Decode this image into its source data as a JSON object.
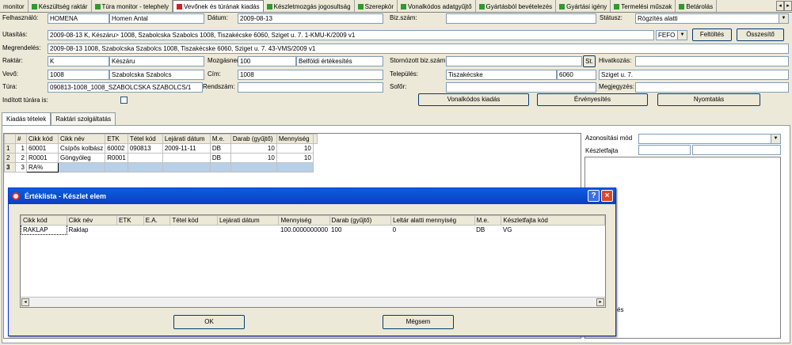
{
  "top_tabs": [
    {
      "label": "monitor",
      "icon": "none"
    },
    {
      "label": "Készültség raktár",
      "icon": "green-module-icon"
    },
    {
      "label": "Túra monitor - telephely",
      "icon": "green-module-icon"
    },
    {
      "label": "Vevőnek és túrának kiadás",
      "icon": "red-module-icon"
    },
    {
      "label": "Készletmozgás jogosultság",
      "icon": "green-module-icon"
    },
    {
      "label": "Szerepkör",
      "icon": "green-module-icon"
    },
    {
      "label": "Vonalkódos adatgyűjtő",
      "icon": "green-module-icon"
    },
    {
      "label": "Gyártásból bevételezés",
      "icon": "green-module-icon"
    },
    {
      "label": "Gyártási igény",
      "icon": "green-module-icon"
    },
    {
      "label": "Termelési műszak",
      "icon": "green-module-icon"
    },
    {
      "label": "Betárolás",
      "icon": "green-module-icon"
    }
  ],
  "form": {
    "felhasznalo_label": "Felhasználó:",
    "felhasznalo_code": "HOMENA",
    "felhasznalo_name": "Homen Antal",
    "datum_label": "Dátum:",
    "datum_value": "2009-08-13",
    "bizszam_label": "Biz.szám:",
    "bizszam_value": "",
    "status_label": "Státusz:",
    "status_value": "Rögzítés alatti",
    "utasitas_label": "Utasítás:",
    "utasitas_value": "2009-08-13 K, Készáru> 1008, Szabolcska Szabolcs 1008, Tiszakécske 6060, Sziget u. 7. 1-KMU-K/2009 v1",
    "fefo_value": "FEFO",
    "feltoltes_label": "Feltöltés",
    "osszesito_label": "Összesítő",
    "megrendeles_label": "Megrendelés:",
    "megrendeles_value": "2009-08-13 1008, Szabolcska Szabolcs 1008, Tiszakécske 6060, Sziget u. 7. 43-VMS/2009 v1",
    "raktar_label": "Raktár:",
    "raktar_code": "K",
    "raktar_name": "Készáru",
    "mozgasnem_label": "Mozgásnem:",
    "mozgasnem_code": "100",
    "mozgasnem_name": "Belföldi értékesítés",
    "stornozott_label": "Stornózott biz.szám:",
    "stornozott_value": "",
    "st_button": "St.",
    "hivatkozas_label": "Hivatkozás:",
    "hivatkozas_value": "",
    "vevo_label": "Vevő:",
    "vevo_code": "1008",
    "vevo_name": "Szabolcska Szabolcs",
    "cim_label": "Cím:",
    "cim_value": "1008",
    "telepules_label": "Település:",
    "telepules_value": "Tiszakécske",
    "irsz_value": "6060",
    "utca_value": "Sziget u. 7.",
    "tura_label": "Túra:",
    "tura_value": "090813-1008_1008_SZABOLCSKA SZABOLCS/1",
    "rendszam_label": "Rendszám:",
    "rendszam_value": "",
    "sofor_label": "Sofőr:",
    "sofor_value": "",
    "megjegyzes_label": "Megjegyzés:",
    "megjegyzes_value": "",
    "inditott_label": "Indított túrára is:",
    "vonalkodos_button": "Vonalkódos kiadás",
    "ervenyesites_button": "Érvényesítés",
    "nyomtatas_button": "Nyomtatás"
  },
  "sub_tabs": [
    "Kiadás tételek",
    "Raktári szolgáltatás"
  ],
  "items_table": {
    "columns": [
      "#",
      "Cikk kód",
      "Cikk név",
      "ETK",
      "Tétel kód",
      "Lejárati dátum",
      "M.e.",
      "Darab (gyűjtő)",
      "Mennyiség"
    ],
    "rows": [
      {
        "row": "1",
        "cells": [
          "1",
          "60001",
          "Csípős kolbász",
          "60002",
          "090813",
          "2009-11-11",
          "DB",
          "10",
          "10"
        ]
      },
      {
        "row": "2",
        "cells": [
          "2",
          "R0001",
          "Göngyöleg",
          "R0001",
          "",
          "",
          "DB",
          "10",
          "10"
        ]
      },
      {
        "row": "3",
        "cells": [
          "3",
          "RA%",
          "",
          "",
          "",
          "",
          "",
          "",
          ""
        ]
      }
    ]
  },
  "right_panel": {
    "azonositasi_label": "Azonosítási mód",
    "keszletfajta_label": "Készletfajta",
    "partial_text": "és"
  },
  "dialog": {
    "title": "Értéklista - Készlet elem",
    "help_label": "?",
    "close_label": "×",
    "columns": [
      "Cikk kód",
      "Cikk név",
      "ETK",
      "E.A.",
      "Tétel kód",
      "Lejárati dátum",
      "Mennyiség",
      "Darab (gyűjtő)",
      "Leltár alatti mennyiség",
      "M.e.",
      "Készletfajta kód"
    ],
    "rows": [
      [
        "RAKLAP",
        "Raklap",
        "",
        "",
        "",
        "",
        "100.0000000000",
        "100",
        "0",
        "DB",
        "VG"
      ]
    ],
    "ok_label": "OK",
    "cancel_label": "Mégsem"
  }
}
